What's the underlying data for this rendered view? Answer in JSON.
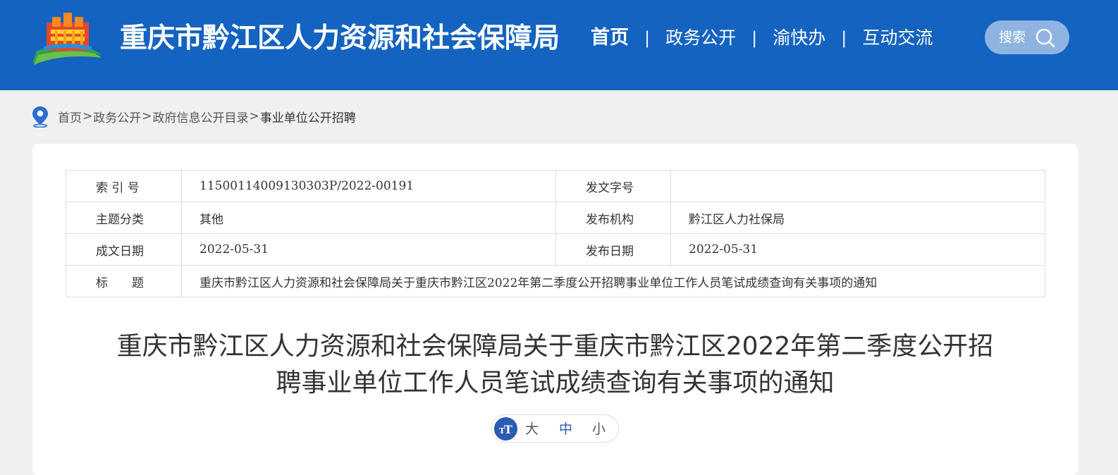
{
  "header": {
    "title": "重庆市黔江区人力资源和社会保障局",
    "nav": [
      {
        "label": "首页"
      },
      {
        "label": "政务公开"
      },
      {
        "label": "渝快办"
      },
      {
        "label": "互动交流"
      }
    ],
    "nav_separator": "|",
    "search_label": "搜索",
    "colors": {
      "header_bg": "#1463c0",
      "search_bg": "#8fb4e2"
    }
  },
  "breadcrumb": {
    "items": [
      "首页",
      "政务公开",
      "政府信息公开目录",
      "事业单位公开招聘"
    ],
    "separator": ">"
  },
  "meta": {
    "index_label": "索 引 号",
    "index_value": "11500114009130303P/2022-00191",
    "doc_no_label": "发文字号",
    "doc_no_value": "",
    "topic_label": "主题分类",
    "topic_value": "其他",
    "publisher_label": "发布机构",
    "publisher_value": "黔江区人力社保局",
    "created_label": "成文日期",
    "created_value": "2022-05-31",
    "published_label": "发布日期",
    "published_value": "2022-05-31",
    "title_label": "标　　题",
    "title_value": "重庆市黔江区人力资源和社会保障局关于重庆市黔江区2022年第二季度公开招聘事业单位工作人员笔试成绩查询有关事项的通知"
  },
  "article": {
    "title_line1": "重庆市黔江区人力资源和社会保障局关于重庆市黔江区2022年第二季度公开招",
    "title_line2": "聘事业单位工作人员笔试成绩查询有关事项的通知"
  },
  "font_size_switch": {
    "large": "大",
    "medium": "中",
    "small": "小",
    "active_color": "#2a5bb5"
  }
}
